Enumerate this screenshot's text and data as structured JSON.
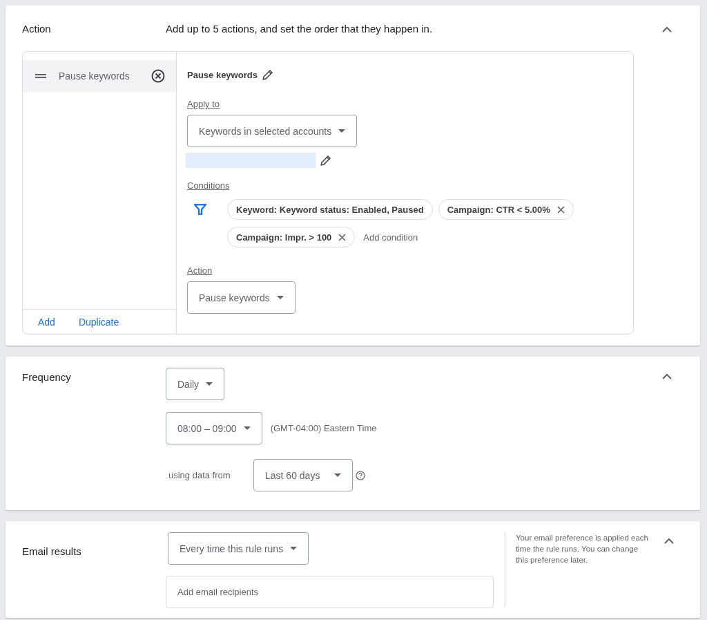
{
  "action_section": {
    "title": "Action",
    "description": "Add up to 5 actions, and set the order that they happen in.",
    "expanded": true,
    "actions": [
      {
        "label": "Pause keywords",
        "selected": true
      }
    ],
    "footer_links": [
      "Add",
      "Duplicate"
    ],
    "detail": {
      "name": "Pause keywords",
      "apply_to": {
        "label": "Apply to",
        "value": "Keywords in selected accounts"
      },
      "conditions": {
        "label": "Conditions",
        "chips": [
          {
            "text": "Keyword: Keyword status: Enabled, Paused",
            "removable": false
          },
          {
            "text": "Campaign: CTR < 5.00%",
            "removable": true
          },
          {
            "text": "Campaign: Impr. > 100",
            "removable": true
          }
        ],
        "add_label": "Add condition"
      },
      "action": {
        "label": "Action",
        "value": "Pause keywords"
      }
    }
  },
  "frequency_section": {
    "title": "Frequency",
    "expanded": true,
    "period": "Daily",
    "time": "08:00 – 09:00",
    "timezone": "(GMT-04:00) Eastern Time",
    "data_label": "using data from",
    "data_range": "Last 60 days"
  },
  "email_section": {
    "title": "Email results",
    "expanded": true,
    "when": "Every time this rule runs",
    "recipients": {
      "placeholder": "Add email recipients"
    },
    "note": "Your email preference is applied each time the rule runs. You can change this preference later."
  }
}
